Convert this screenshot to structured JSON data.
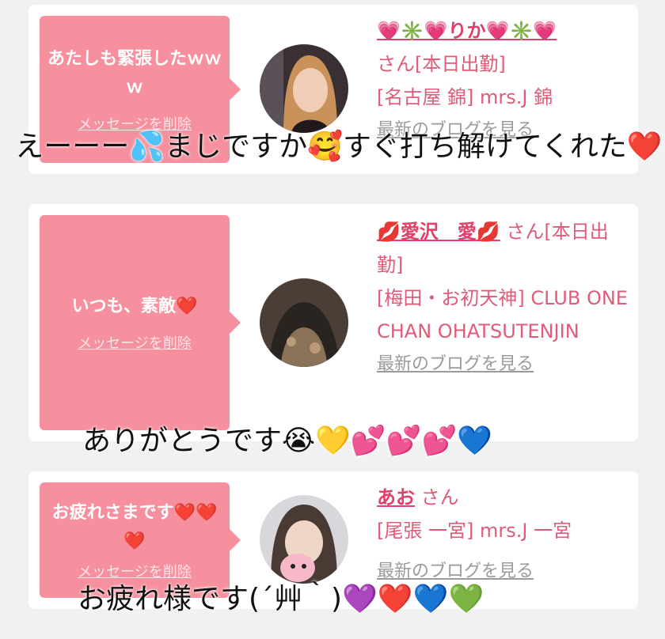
{
  "cards": [
    {
      "message": "あたしも緊張したｗｗｗ",
      "delete_label": "メッセージを削除",
      "name": "💗✳️💗りか💗✳️💗",
      "san": "さん[本日出勤]",
      "shop": "[名古屋 錦] mrs.J 錦",
      "blog_label": "最新のブログを見る"
    },
    {
      "message": "いつも、素敵❤️",
      "delete_label": "メッセージを削除",
      "name": "💋愛沢　愛💋",
      "san": "さん[本日出勤]",
      "shop": "[梅田・お初天神] CLUB ONE CHAN OHATSUTENJIN",
      "blog_label": "最新のブログを見る"
    },
    {
      "message": "お疲れさまです❤️❤️❤️",
      "delete_label": "メッセージを削除",
      "name": "あお",
      "san": "さん",
      "shop": "[尾張 一宮] mrs.J 一宮",
      "blog_label": "最新のブログを見る"
    }
  ],
  "captions": [
    "えーーー💦まじですか🥰すぐ打ち解けてくれた❤️",
    "ありがとうです😭💛💕💕💕💙",
    "お疲れ様です(´艸｀)💜❤️💙💚"
  ],
  "colors": {
    "bubble": "#f6909e",
    "name": "#e0406a",
    "text": "#e05b78",
    "background": "#f1f1f1"
  }
}
